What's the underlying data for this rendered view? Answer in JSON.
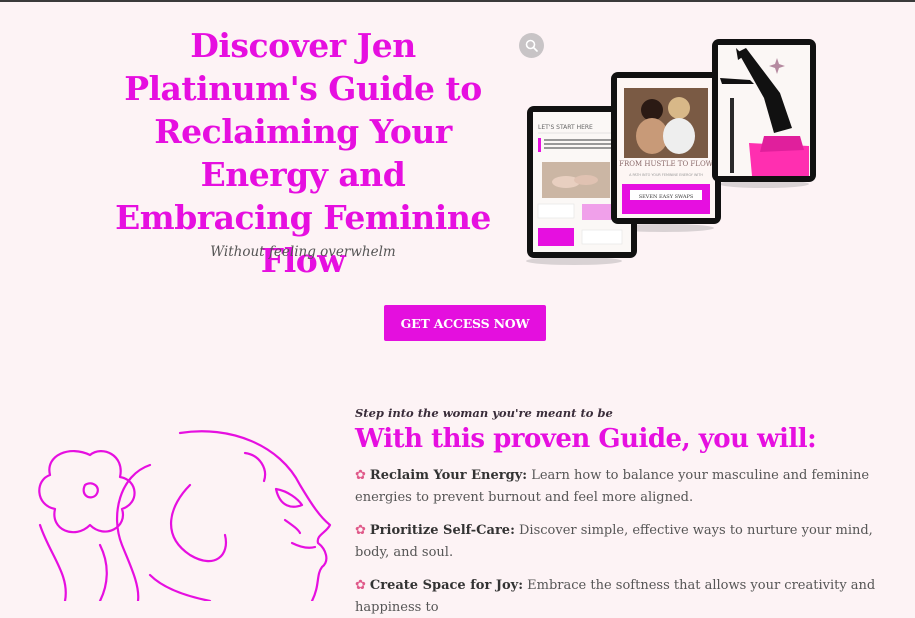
{
  "hero": {
    "title": "Discover Jen Platinum's Guide to Reclaiming Your Energy and Embracing Feminine Flow",
    "subtitle": "Without feeling overwhelm"
  },
  "mockups": {
    "ebook_cover_title": "FROM HUSTLE TO FLOW",
    "ebook_cover_subtitle": "A PATH INTO YOUR FEMININE ENERGY WITH",
    "ebook_cover_banner": "SEVEN EASY SWAPS",
    "page_header": "LET'S START HERE"
  },
  "cta": {
    "label": "GET ACCESS NOW"
  },
  "guide": {
    "tagline": "Step into the woman you're meant to be",
    "title": "With this proven Guide, you will:",
    "benefits": [
      {
        "icon": "flower-icon",
        "lead": "Reclaim Your Energy:",
        "text": " Learn how to balance your masculine and feminine energies to prevent burnout and feel more aligned."
      },
      {
        "icon": "flower-icon",
        "lead": "Prioritize Self-Care:",
        "text": " Discover simple, effective ways to nurture your mind, body, and soul."
      },
      {
        "icon": "flower-icon",
        "lead": "Create Space for Joy:",
        "text": " Embrace the softness that allows your creativity and happiness to"
      }
    ]
  },
  "colors": {
    "accent": "#e60fe0",
    "background": "#fdf3f5"
  }
}
